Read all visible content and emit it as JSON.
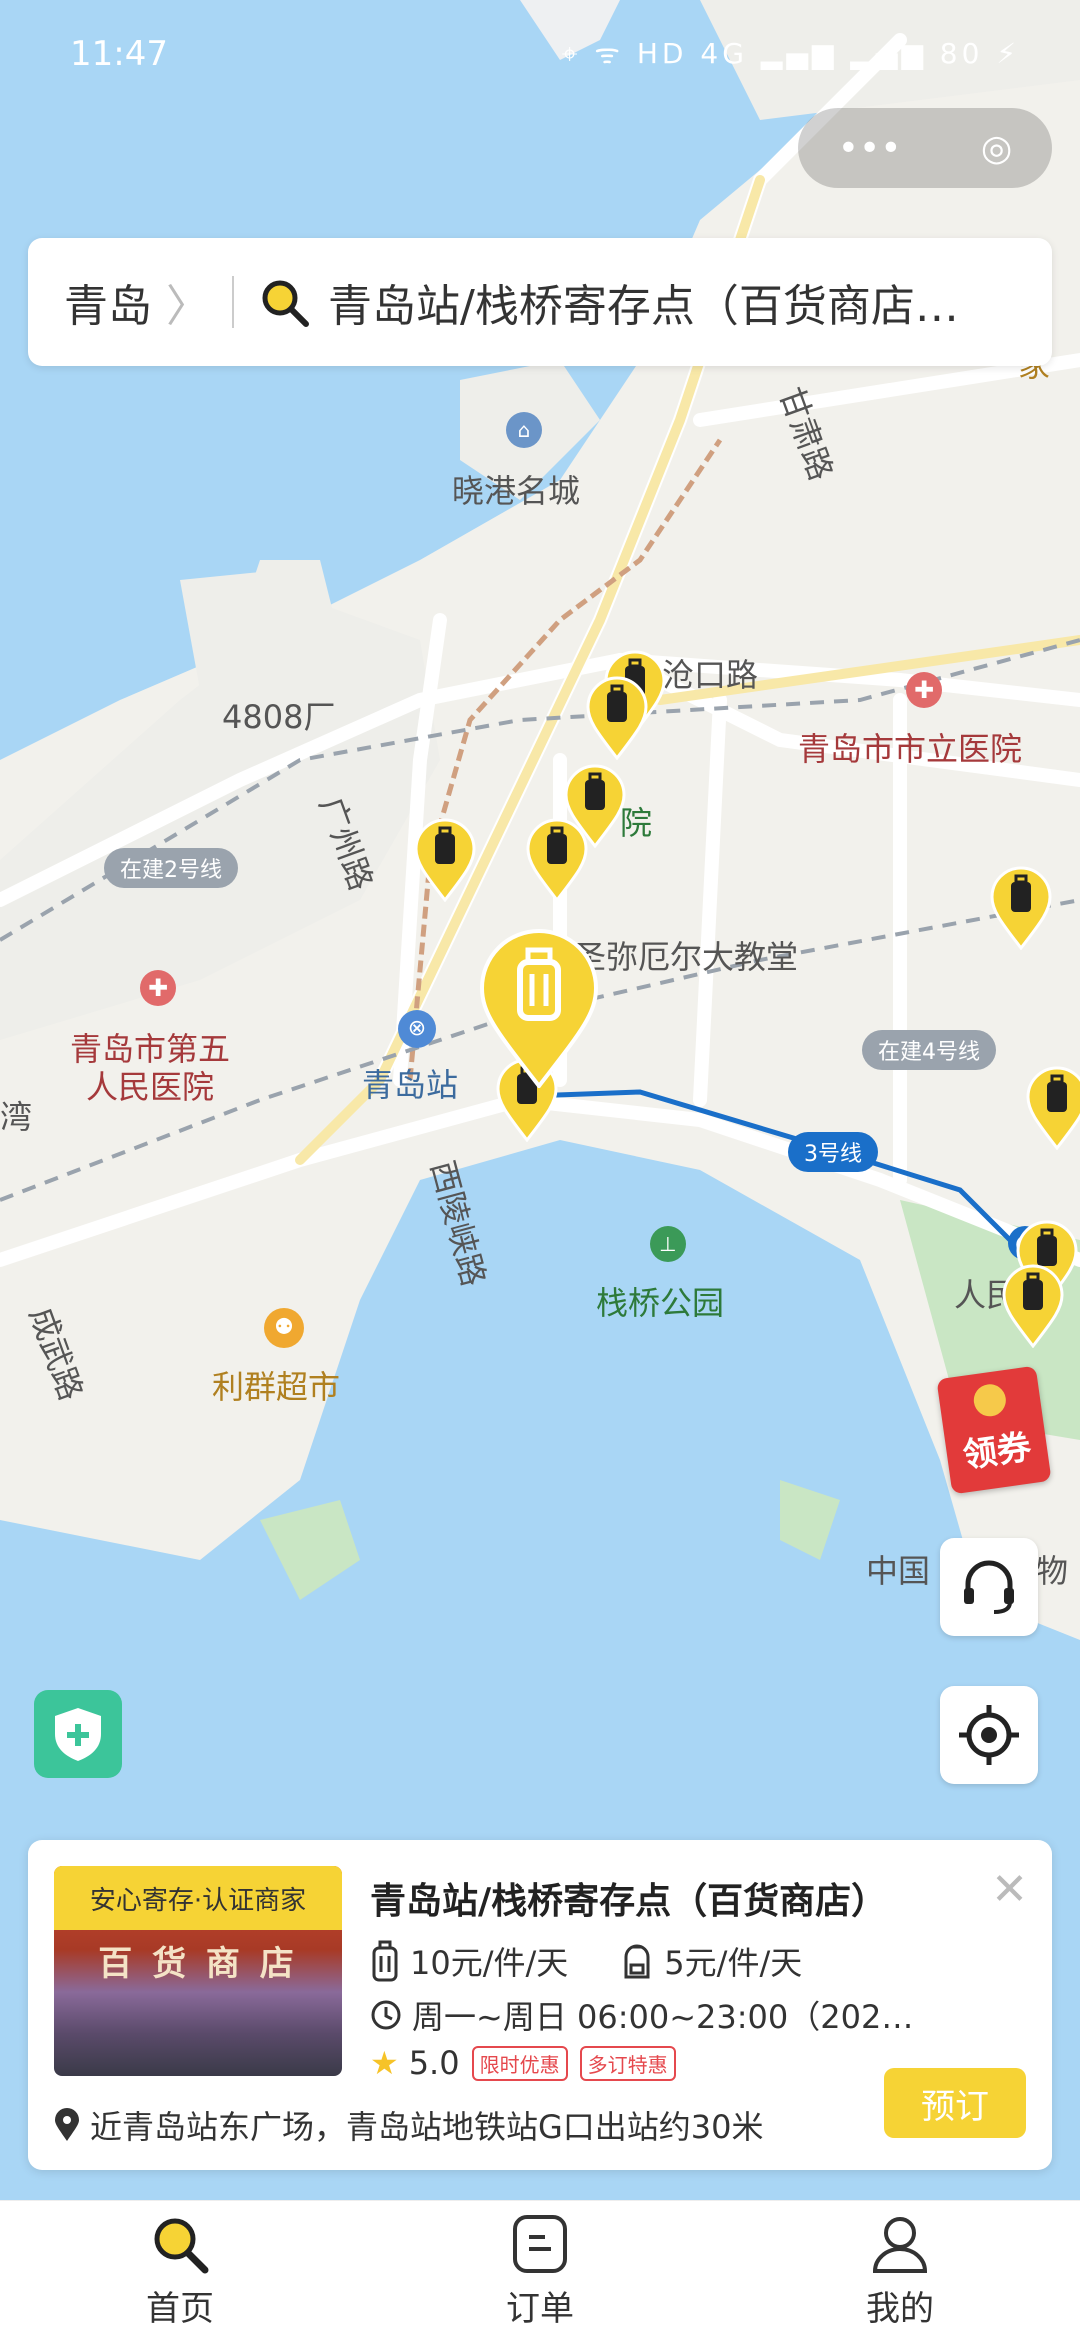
{
  "status": {
    "time": "11:47",
    "icons": "⌖ ᯤ HD 4G ▂▄▆ ▂▄▆ 80 ⚡"
  },
  "capsule": {
    "more": "•••",
    "target": "◎"
  },
  "search": {
    "city": "青岛",
    "chevron": "〉",
    "query": "青岛站/栈桥寄存点（百货商店…"
  },
  "map": {
    "labels": {
      "xiaogang": "晓港名城",
      "factory": "4808厂",
      "cangkou": "沧口路",
      "hospital_city": "青岛市市立医院",
      "church": "圣弥厄尔大教堂",
      "guangzhou": "广州路",
      "hospital5_line1": "青岛市第五",
      "hospital5_line2": "人民医院",
      "station": "青岛站",
      "xiling": "西陵峡路",
      "zhanqiao": "栈桥公园",
      "liqun": "利群超市",
      "chengwu": "成武路",
      "zhongguo": "中国",
      "jiakou": "家",
      "renmin": "人民",
      "wan": "湾",
      "yuan": "院",
      "gansu": "甘肃路",
      "wu": "物"
    },
    "badges": {
      "line2": "在建2号线",
      "line4": "在建4号线",
      "line3": "3号线"
    },
    "selected_pin_icon": "luggage-icon"
  },
  "coupon": {
    "label": "领券"
  },
  "card": {
    "cert": "安心寄存·认证商家",
    "title": "青岛站/栈桥寄存点（百货商店）",
    "close": "✕",
    "price_large": "10元/件/天",
    "price_small": "5元/件/天",
    "hours": "周一~周日 06:00~23:00（202…",
    "rating": "5.0",
    "tag1": "限时优惠",
    "tag2": "多订特惠",
    "address": "近青岛站东广场，青岛站地铁站G口出站约30米",
    "book": "预订",
    "photo_sign": "百 货 商 店"
  },
  "tabs": [
    {
      "label": "首页",
      "icon": "search-icon"
    },
    {
      "label": "订单",
      "icon": "order-icon"
    },
    {
      "label": "我的",
      "icon": "user-icon"
    }
  ],
  "colors": {
    "accent": "#f6d335",
    "sea": "#a9d6f5",
    "land": "#f2f1ec",
    "metro": "#1a6fc9"
  }
}
